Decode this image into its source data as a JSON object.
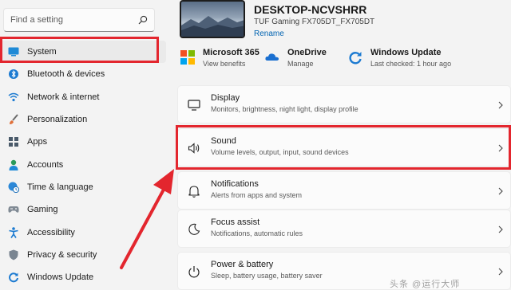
{
  "search": {
    "placeholder": "Find a setting"
  },
  "sidebar": {
    "items": [
      {
        "label": "System",
        "icon": "display-icon"
      },
      {
        "label": "Bluetooth & devices",
        "icon": "bluetooth-icon"
      },
      {
        "label": "Network & internet",
        "icon": "wifi-icon"
      },
      {
        "label": "Personalization",
        "icon": "brush-icon"
      },
      {
        "label": "Apps",
        "icon": "apps-icon"
      },
      {
        "label": "Accounts",
        "icon": "person-icon"
      },
      {
        "label": "Time & language",
        "icon": "globe-clock-icon"
      },
      {
        "label": "Gaming",
        "icon": "gamepad-icon"
      },
      {
        "label": "Accessibility",
        "icon": "accessibility-icon"
      },
      {
        "label": "Privacy & security",
        "icon": "shield-icon"
      },
      {
        "label": "Windows Update",
        "icon": "update-icon"
      }
    ]
  },
  "device": {
    "name": "DESKTOP-NCVSHRR",
    "model": "TUF Gaming FX705DT_FX705DT",
    "rename": "Rename"
  },
  "quick": [
    {
      "title": "Microsoft 365",
      "sub": "View benefits",
      "icon": "microsoft-logo-icon"
    },
    {
      "title": "OneDrive",
      "sub": "Manage",
      "icon": "cloud-icon"
    },
    {
      "title": "Windows Update",
      "sub": "Last checked: 1 hour ago",
      "icon": "update-icon"
    }
  ],
  "cards": [
    {
      "title": "Display",
      "sub": "Monitors, brightness, night light, display profile",
      "icon": "monitor-icon"
    },
    {
      "title": "Sound",
      "sub": "Volume levels, output, input, sound devices",
      "icon": "speaker-icon"
    },
    {
      "title": "Notifications",
      "sub": "Alerts from apps and system",
      "icon": "bell-icon"
    },
    {
      "title": "Focus assist",
      "sub": "Notifications, automatic rules",
      "icon": "moon-icon"
    },
    {
      "title": "Power & battery",
      "sub": "Sleep, battery usage, battery saver",
      "icon": "power-icon"
    }
  ],
  "watermark": "头条 @运行大师"
}
